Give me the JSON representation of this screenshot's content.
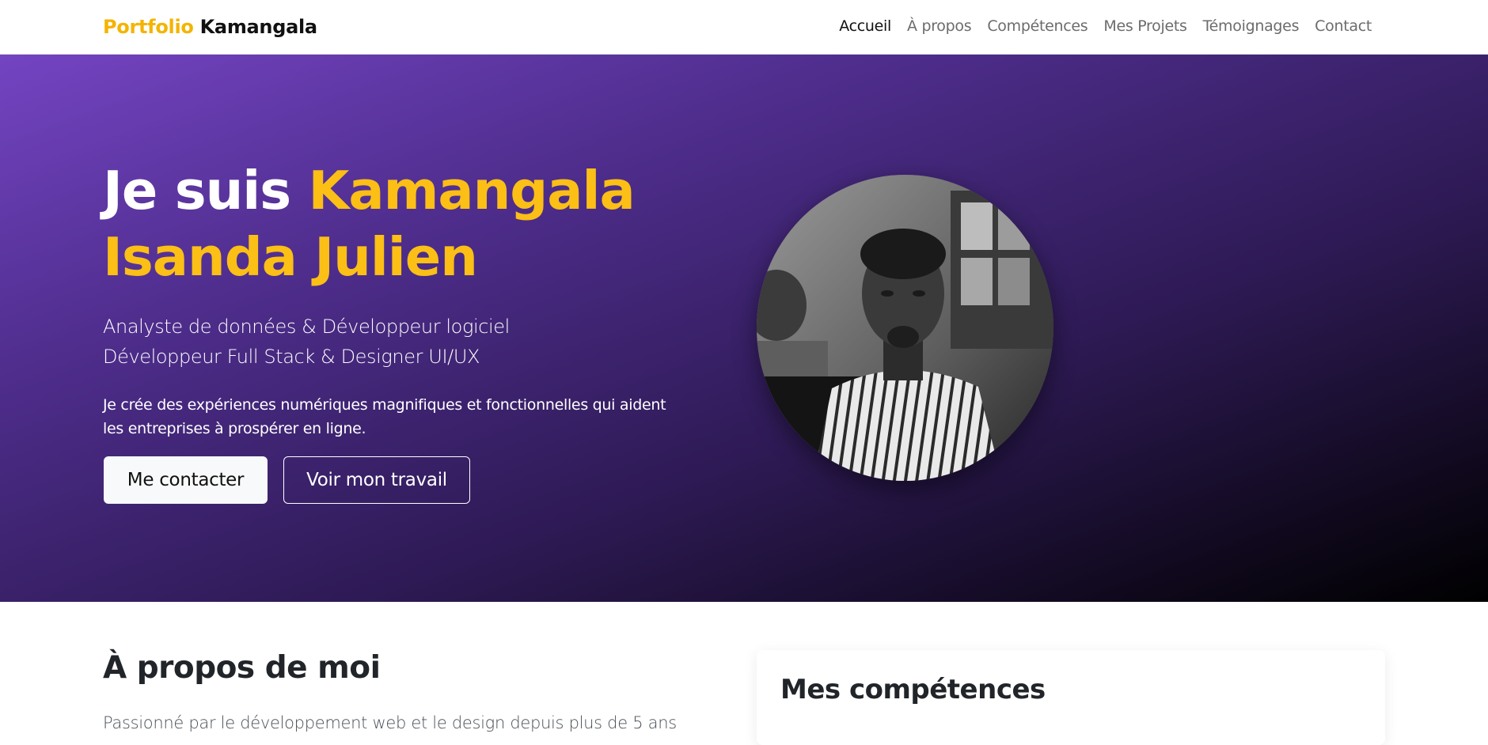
{
  "brand": {
    "part1": "Portfolio",
    "part2": "Kamangala"
  },
  "nav": {
    "items": [
      {
        "label": "Accueil",
        "active": true
      },
      {
        "label": "À propos",
        "active": false
      },
      {
        "label": "Compétences",
        "active": false
      },
      {
        "label": "Mes Projets",
        "active": false
      },
      {
        "label": "Témoignages",
        "active": false
      },
      {
        "label": "Contact",
        "active": false
      }
    ]
  },
  "hero": {
    "title_prefix": "Je suis",
    "title_name_line1": "Kamangala",
    "title_name_line2": "Isanda Julien",
    "subtitle_line1": "Analyste de données & Développeur logiciel",
    "subtitle_line2": "Développeur Full Stack & Designer UI/UX",
    "description": "Je crée des expériences numériques magnifiques et fonctionnelles qui aident les entreprises à prospérer en ligne.",
    "primary_button": "Me contacter",
    "secondary_button": "Voir mon travail"
  },
  "about": {
    "title": "À propos de moi",
    "text": "Passionné par le développement web et le design depuis plus de 5 ans"
  },
  "skills": {
    "title": "Mes compétences"
  },
  "colors": {
    "accent": "#fbbf16",
    "brand_accent": "#f4b400",
    "hero_gradient_start": "#7444c2",
    "hero_gradient_end": "#000000"
  }
}
